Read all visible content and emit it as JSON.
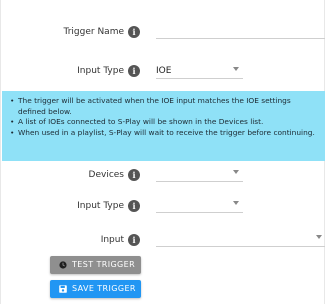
{
  "form": {
    "trigger_name": {
      "label": "Trigger Name",
      "value": ""
    },
    "input_type_top": {
      "label": "Input Type",
      "value": "IOE"
    },
    "devices": {
      "label": "Devices",
      "value": ""
    },
    "input_type_bottom": {
      "label": "Input Type",
      "value": ""
    },
    "input": {
      "label": "Input",
      "value": ""
    }
  },
  "info": {
    "items": [
      "The trigger will be activated when the IOE input matches the IOE settings defined below.",
      "A list of IOEs connected to S-Play will be shown in the Devices list.",
      "When used in a playlist, S-Play will wait to receive the trigger before continuing."
    ],
    "background": "#8fe1f7"
  },
  "buttons": {
    "test_label": "TEST TRIGGER",
    "save_label": "SAVE TRIGGER",
    "test_color": "#8f8f8f",
    "save_color": "#2196f3"
  },
  "icons": {
    "info": "info-icon",
    "dropdown": "chevron-down-icon",
    "test": "stopwatch-icon",
    "save": "floppy-disk-icon"
  }
}
